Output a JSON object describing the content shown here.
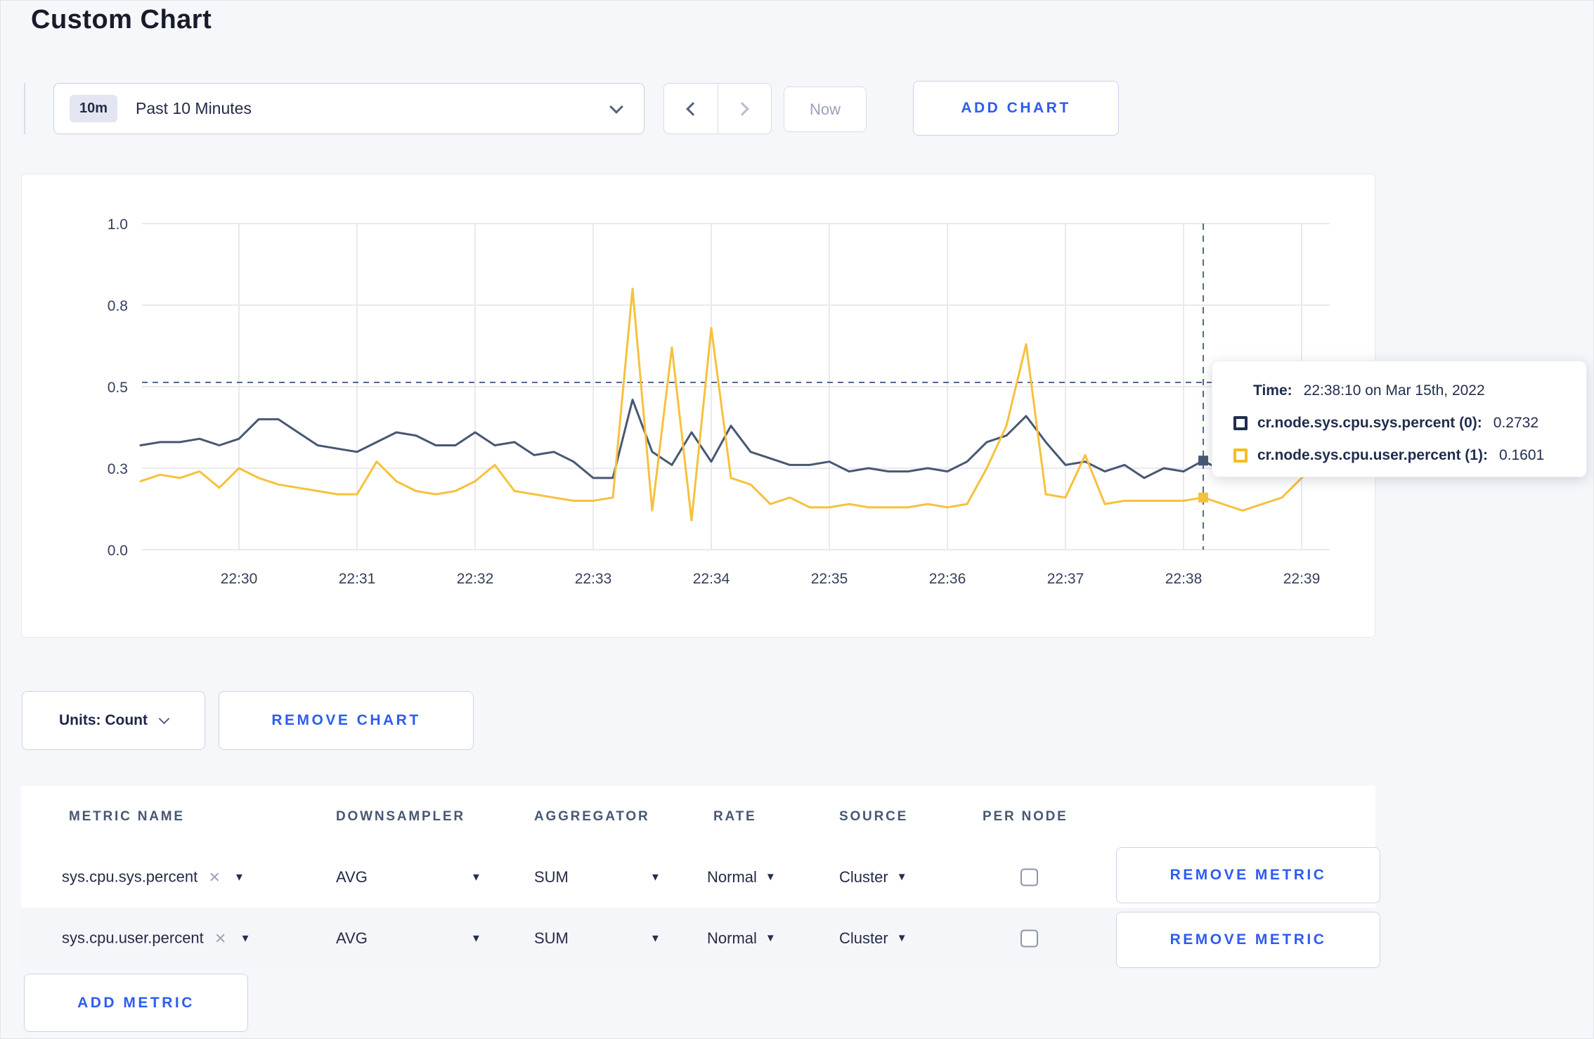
{
  "page": {
    "title": "Custom Chart"
  },
  "toolbar": {
    "range_badge": "10m",
    "range_label": "Past 10 Minutes",
    "now_label": "Now",
    "add_chart_label": "ADD CHART"
  },
  "chart_controls": {
    "units_label": "Units: Count",
    "remove_chart_label": "REMOVE CHART"
  },
  "tooltip": {
    "time_label": "Time:",
    "time_value": "22:38:10 on Mar 15th, 2022",
    "series": [
      {
        "label": "cr.node.sys.cpu.sys.percent (0):",
        "value": "0.2732",
        "swatch_color": "#1f2d4d"
      },
      {
        "label": "cr.node.sys.cpu.user.percent (1):",
        "value": "0.1601",
        "swatch_color": "#f5bd1f"
      }
    ]
  },
  "table": {
    "headers": [
      "METRIC NAME",
      "DOWNSAMPLER",
      "AGGREGATOR",
      "RATE",
      "SOURCE",
      "PER NODE"
    ],
    "rows": [
      {
        "metric": "sys.cpu.sys.percent",
        "downsampler": "AVG",
        "aggregator": "SUM",
        "rate": "Normal",
        "source": "Cluster",
        "per_node": false,
        "remove_label": "REMOVE METRIC"
      },
      {
        "metric": "sys.cpu.user.percent",
        "downsampler": "AVG",
        "aggregator": "SUM",
        "rate": "Normal",
        "source": "Cluster",
        "per_node": false,
        "remove_label": "REMOVE METRIC"
      }
    ],
    "add_metric_label": "ADD METRIC"
  },
  "chart_data": {
    "type": "line",
    "title": "",
    "x_axis": {
      "start_time": "22:29:10",
      "step_seconds": 10,
      "t_start_min": -0.8333,
      "t_step_min": 0.16667,
      "ticks": [
        {
          "t": 0,
          "label": "22:30"
        },
        {
          "t": 1,
          "label": "22:31"
        },
        {
          "t": 2,
          "label": "22:32"
        },
        {
          "t": 3,
          "label": "22:33"
        },
        {
          "t": 4,
          "label": "22:34"
        },
        {
          "t": 5,
          "label": "22:35"
        },
        {
          "t": 6,
          "label": "22:36"
        },
        {
          "t": 7,
          "label": "22:37"
        },
        {
          "t": 8,
          "label": "22:38"
        },
        {
          "t": 9,
          "label": "22:39"
        }
      ]
    },
    "y_axis": {
      "ylim": [
        0,
        1
      ],
      "ticks": [
        {
          "v": 0,
          "label": "0.0"
        },
        {
          "v": 0.25,
          "label": "0.3"
        },
        {
          "v": 0.5,
          "label": "0.5"
        },
        {
          "v": 0.75,
          "label": "0.8"
        },
        {
          "v": 1,
          "label": "1.0"
        }
      ]
    },
    "series": [
      {
        "name": "cr.node.sys.cpu.sys.percent",
        "color": "#475872",
        "values": [
          0.32,
          0.33,
          0.33,
          0.34,
          0.32,
          0.34,
          0.4,
          0.4,
          0.36,
          0.32,
          0.31,
          0.3,
          0.33,
          0.36,
          0.35,
          0.32,
          0.32,
          0.36,
          0.32,
          0.33,
          0.29,
          0.3,
          0.27,
          0.22,
          0.22,
          0.46,
          0.3,
          0.26,
          0.36,
          0.27,
          0.38,
          0.3,
          0.28,
          0.26,
          0.26,
          0.27,
          0.24,
          0.25,
          0.24,
          0.24,
          0.25,
          0.24,
          0.27,
          0.33,
          0.35,
          0.41,
          0.33,
          0.26,
          0.27,
          0.24,
          0.26,
          0.22,
          0.25,
          0.24,
          0.2732,
          0.24,
          0.29,
          0.29,
          0.29,
          0.3,
          0.3
        ]
      },
      {
        "name": "cr.node.sys.cpu.user.percent",
        "color": "#f6c13c",
        "values": [
          0.21,
          0.23,
          0.22,
          0.24,
          0.19,
          0.25,
          0.22,
          0.2,
          0.19,
          0.18,
          0.17,
          0.17,
          0.27,
          0.21,
          0.18,
          0.17,
          0.18,
          0.21,
          0.26,
          0.18,
          0.17,
          0.16,
          0.15,
          0.15,
          0.16,
          0.8,
          0.12,
          0.62,
          0.09,
          0.68,
          0.22,
          0.2,
          0.14,
          0.16,
          0.13,
          0.13,
          0.14,
          0.13,
          0.13,
          0.13,
          0.14,
          0.13,
          0.14,
          0.25,
          0.38,
          0.63,
          0.17,
          0.16,
          0.29,
          0.14,
          0.15,
          0.15,
          0.15,
          0.15,
          0.1601,
          0.14,
          0.12,
          0.14,
          0.16,
          0.22,
          0.27
        ]
      }
    ],
    "crosshair": {
      "index": 54,
      "time": "22:38:10",
      "hline_value": 0.513
    },
    "style_colors": {
      "grid": "#e9eaef",
      "crosshair": "#54678d"
    },
    "legend_position": "tooltip",
    "grid": true
  }
}
